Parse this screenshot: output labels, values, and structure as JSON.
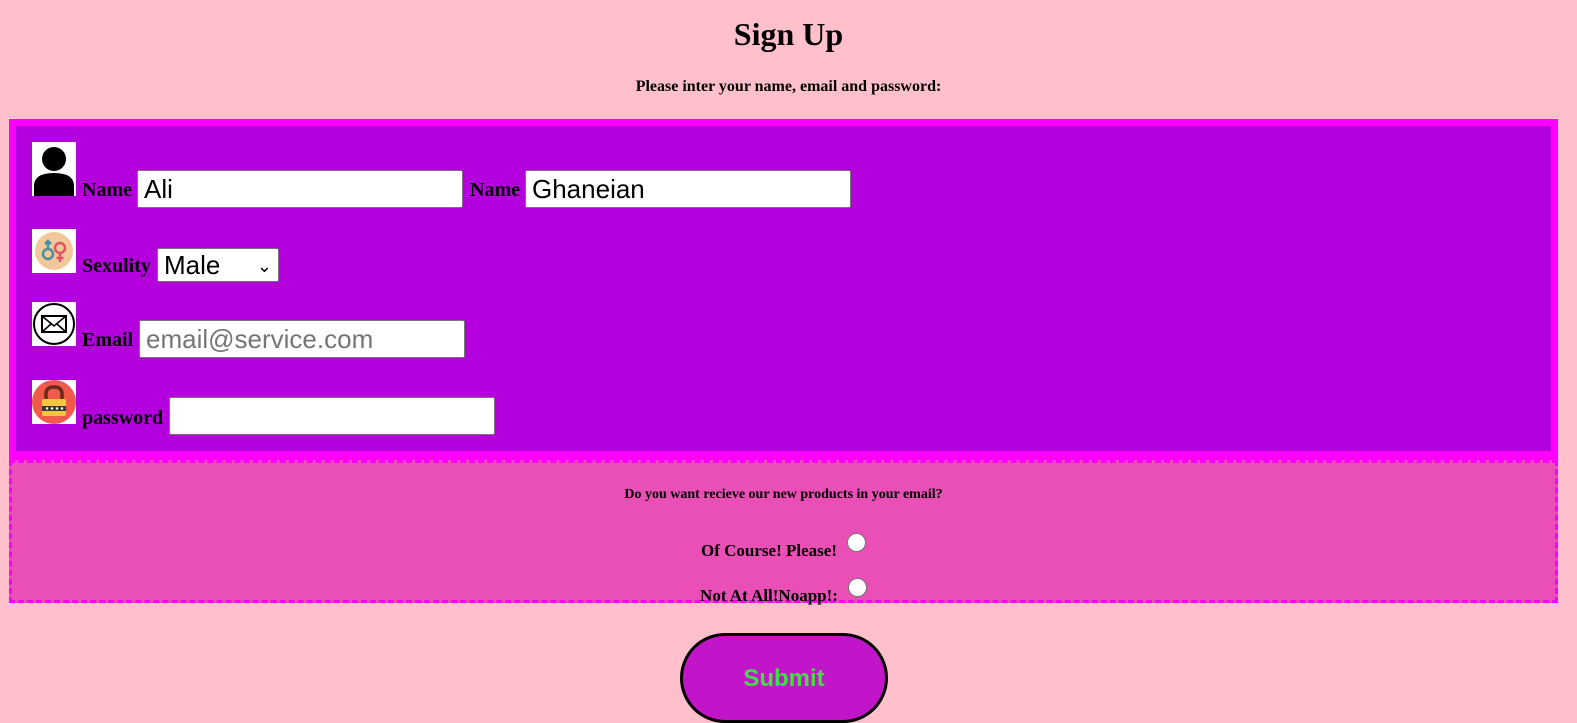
{
  "header": {
    "title": "Sign Up",
    "subtitle": "Please inter your name, email and password:"
  },
  "form": {
    "first_name": {
      "label": "Name",
      "value": "Ali"
    },
    "last_name": {
      "label": "Name",
      "value": "Ghaneian"
    },
    "sexuality": {
      "label": "Sexulity",
      "selected": "Male"
    },
    "email": {
      "label": "Email",
      "placeholder": "email@service.com",
      "value": ""
    },
    "password": {
      "label": "password",
      "value": ""
    }
  },
  "newsletter": {
    "question": "Do you want recieve our new products in your email?",
    "options": [
      {
        "label": "Of Course! Please!",
        "selected": false
      },
      {
        "label": "Not At All!Noapp!:",
        "selected": false
      }
    ]
  },
  "submit": {
    "label": "Submit"
  },
  "colors": {
    "page_bg": "#ffc0cb",
    "form_border": "#ff00ff",
    "form_bg": "#b400dc",
    "news_bg": "#e94fb5",
    "submit_bg": "#c214c8",
    "submit_text": "#44dd44"
  },
  "icons": {
    "name": "person-icon",
    "sexuality": "gender-icon",
    "email": "envelope-icon",
    "password": "padlock-icon"
  }
}
